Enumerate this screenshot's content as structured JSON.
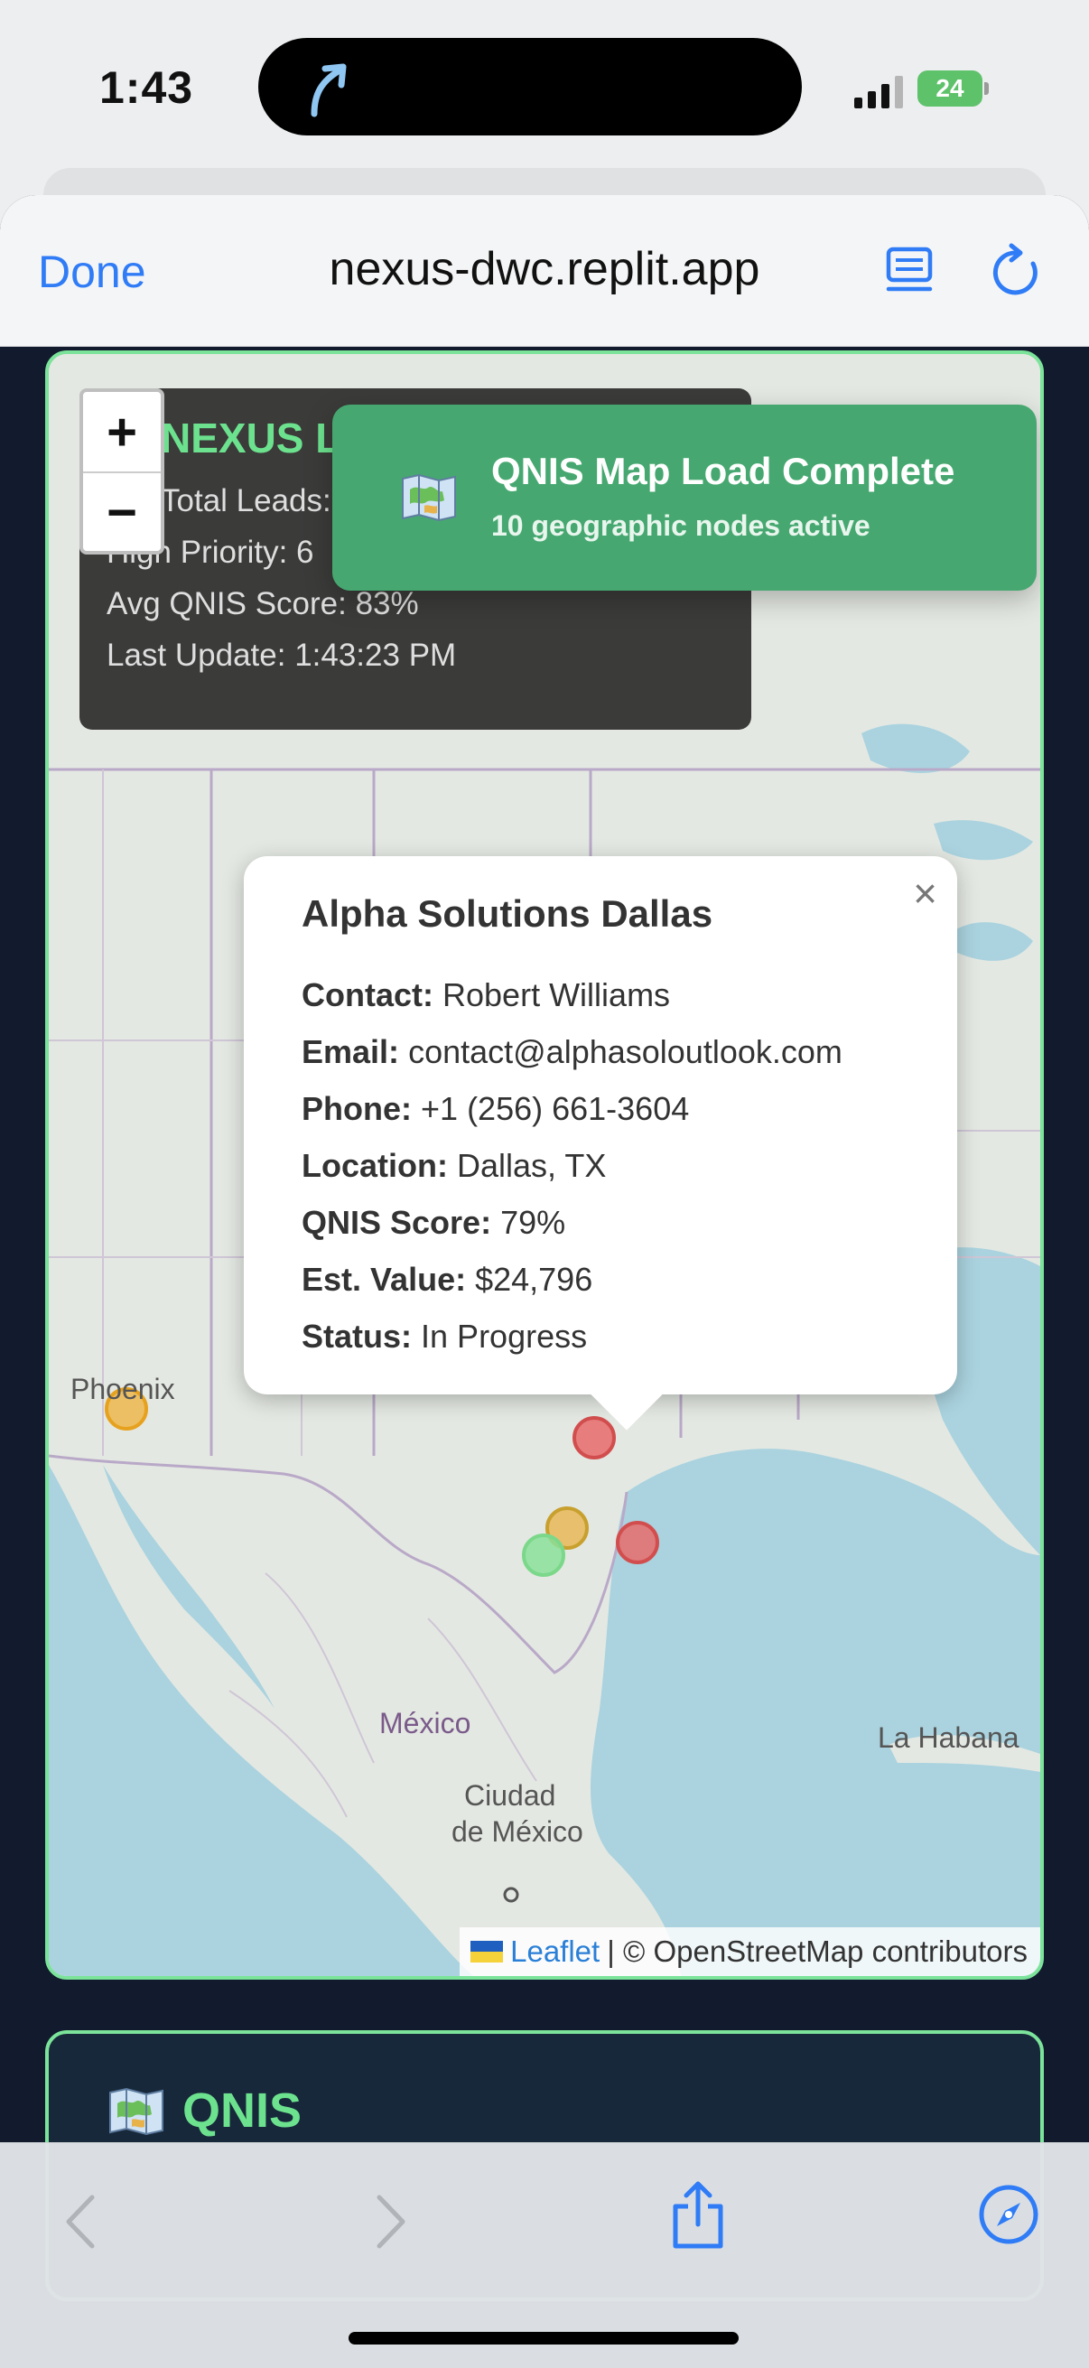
{
  "status_bar": {
    "time": "1:43",
    "battery": "24"
  },
  "browser": {
    "done_label": "Done",
    "url": "nexus-dwc.replit.app"
  },
  "stats": {
    "title": "NEXUS Lea",
    "lines": [
      "Total Leads: 25",
      "High Priority: 6",
      "Avg QNIS Score: 83%",
      "Last Update: 1:43:23 PM"
    ]
  },
  "zoom": {
    "in": "+",
    "out": "−"
  },
  "toast": {
    "icon": "map-icon",
    "title": "QNIS Map Load Complete",
    "subtitle": "10 geographic nodes active"
  },
  "popup": {
    "close": "×",
    "title": "Alpha Solutions Dallas",
    "rows": [
      {
        "label": "Contact:",
        "value": "Robert Williams"
      },
      {
        "label": "Email:",
        "value": "contact@alphasoloutlook.com"
      },
      {
        "label": "Phone:",
        "value": "+1 (256) 661-3604"
      },
      {
        "label": "Location:",
        "value": "Dallas, TX"
      },
      {
        "label": "QNIS Score:",
        "value": "79%"
      },
      {
        "label": "Est. Value:",
        "value": "$24,796"
      },
      {
        "label": "Status:",
        "value": "In Progress"
      }
    ]
  },
  "map": {
    "labels": {
      "phoenix": "Phoenix",
      "mexico": "México",
      "ciudad_1": "Ciudad",
      "ciudad_2": "de México",
      "habana": "La Habana"
    },
    "attribution": {
      "leaflet": "Leaflet",
      "rest": "| © OpenStreetMap contributors"
    },
    "markers": [
      {
        "name": "phoenix-lead-marker",
        "color": "#f0b23a"
      },
      {
        "name": "dallas-lead-marker",
        "color": "#e86b6b"
      },
      {
        "name": "austin-lead-marker",
        "color": "#e9b246"
      },
      {
        "name": "san-antonio-lead-marker",
        "color": "#8be09a"
      },
      {
        "name": "houston-lead-marker",
        "color": "#e86b6b"
      }
    ]
  },
  "qnis_section": {
    "title": "QNIS"
  },
  "colors": {
    "accent_green": "#6ce28e",
    "toast_green": "#46a870",
    "ios_blue": "#2f7cf6"
  }
}
